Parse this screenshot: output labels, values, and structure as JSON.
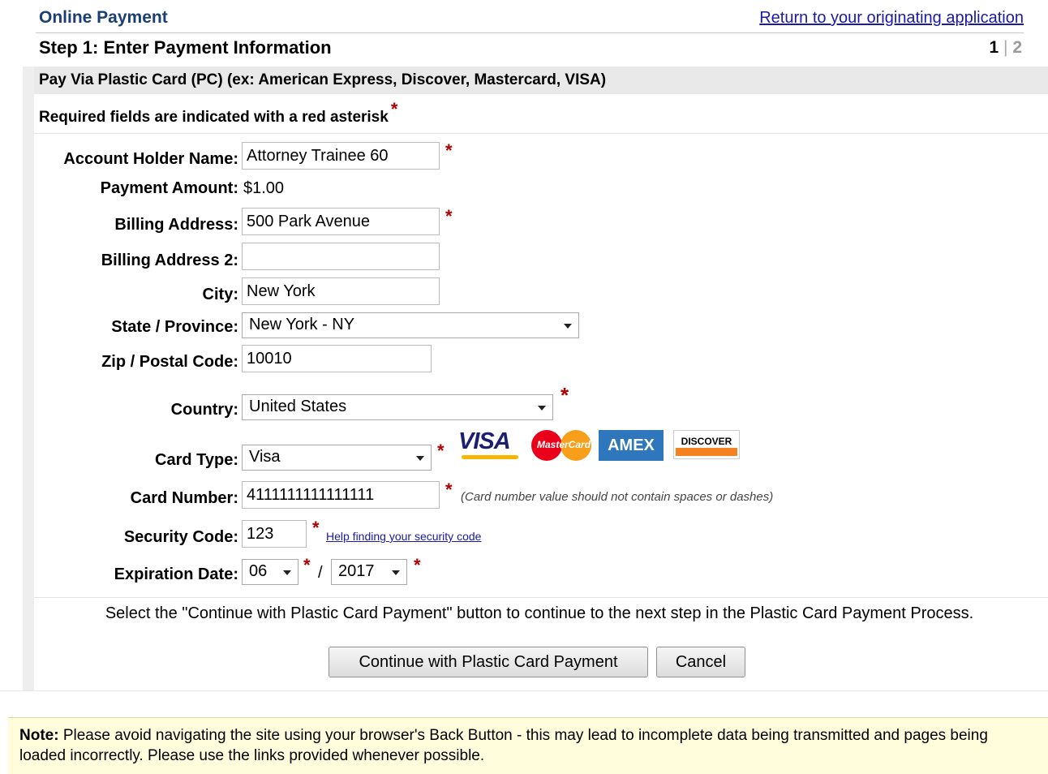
{
  "header": {
    "title": "Online Payment",
    "return_link": "Return to your originating application"
  },
  "step": {
    "title": "Step 1: Enter Payment Information",
    "current": "1",
    "separator": "|",
    "next": "2"
  },
  "section": {
    "pay_via": "Pay Via Plastic Card (PC) (ex: American Express, Discover, Mastercard, VISA)",
    "required_note": "Required fields are indicated with a red asterisk",
    "asterisk": "*"
  },
  "form": {
    "account_holder_label": "Account Holder Name:",
    "account_holder_value": "Attorney Trainee 60",
    "payment_amount_label": "Payment Amount:",
    "payment_amount_value": "$1.00",
    "billing_address_label": "Billing Address:",
    "billing_address_value": "500 Park Avenue",
    "billing_address2_label": "Billing Address 2:",
    "billing_address2_value": "",
    "city_label": "City:",
    "city_value": "New York",
    "state_label": "State / Province:",
    "state_value": "New York - NY",
    "zip_label": "Zip / Postal Code:",
    "zip_value": "10010",
    "country_label": "Country:",
    "country_value": "United States",
    "card_type_label": "Card Type:",
    "card_type_value": "Visa",
    "card_number_label": "Card Number:",
    "card_number_value": "4111111111111111",
    "card_number_hint": "(Card number value should not contain spaces or dashes)",
    "security_code_label": "Security Code:",
    "security_code_value": "123",
    "security_help_link": "Help finding your security code",
    "expiration_label": "Expiration Date:",
    "expiration_month": "06",
    "expiration_separator": "/",
    "expiration_year": "2017"
  },
  "card_logos": {
    "visa": "VISA",
    "mastercard": "MasterCard",
    "amex": "AMEX",
    "discover": "DISCOVER"
  },
  "instructions": "Select the \"Continue with Plastic Card Payment\" button to continue to the next step in the Plastic Card Payment Process.",
  "buttons": {
    "continue": "Continue with Plastic Card Payment",
    "cancel": "Cancel"
  },
  "note": {
    "label": "Note:",
    "text": " Please avoid navigating the site using your browser's Back Button - this may lead to incomplete data being transmitted and pages being loaded incorrectly. Please use the links provided whenever possible."
  },
  "colors": {
    "header_blue": "#1b3f73",
    "link_blue": "#1a1aa6",
    "required_red": "#b00000",
    "note_bg": "#fffddc"
  }
}
